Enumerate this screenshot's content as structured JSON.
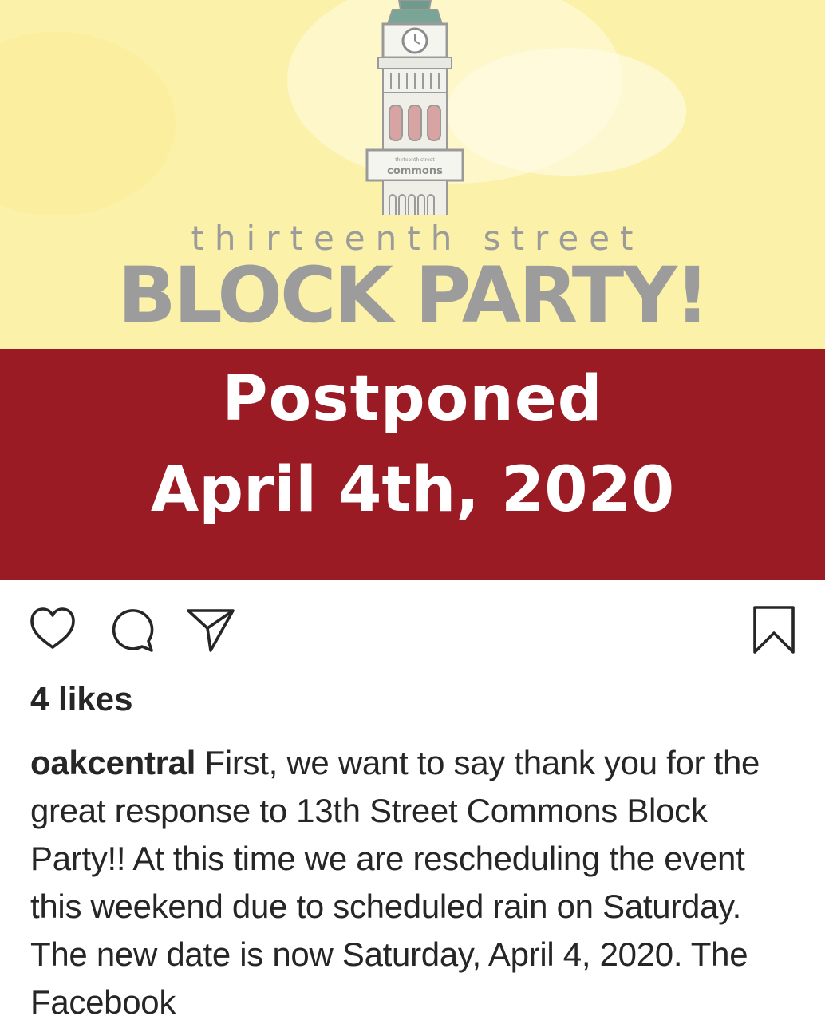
{
  "poster": {
    "tower_sign_small": "thirteenth street",
    "tower_sign": "commons",
    "subtitle": "thirteenth street",
    "headline": "BLOCK PARTY!",
    "banner_line1": "Postponed",
    "banner_line2": "April 4th, 2020",
    "colors": {
      "top_bg": "#fbf1a8",
      "banner_bg": "#9a1b24",
      "headline": "#9c9c9c"
    }
  },
  "actions": {
    "like_icon": "heart-icon",
    "comment_icon": "comment-icon",
    "share_icon": "paper-plane-icon",
    "save_icon": "bookmark-icon"
  },
  "likes": "4 likes",
  "caption": {
    "username": "oakcentral",
    "text": "First, we want to say thank you for the great response to 13th Street Commons Block Party!! At this time we are rescheduling the event this weekend due to scheduled rain on Saturday.  The new date is now Saturday, April 4, 2020.  The Facebook"
  }
}
